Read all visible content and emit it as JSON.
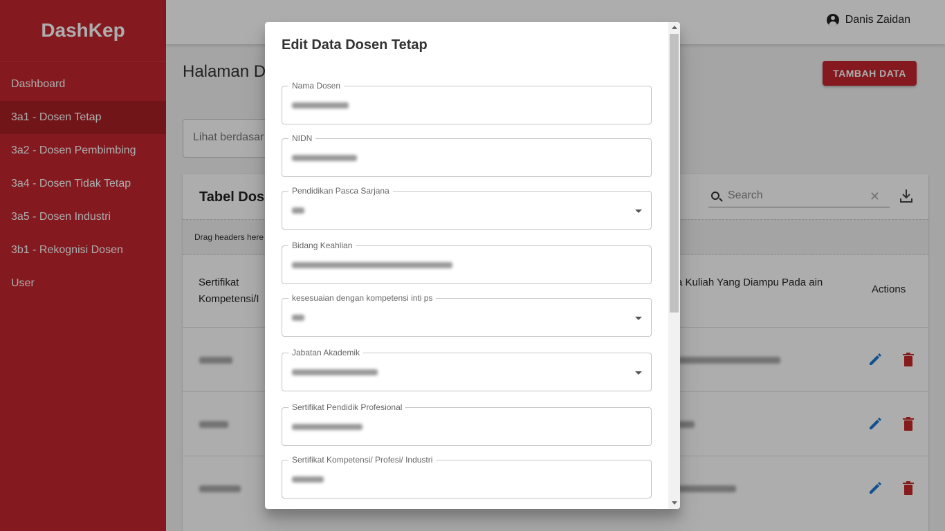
{
  "brand": "DashKep",
  "sidebar": {
    "items": [
      {
        "label": "Dashboard"
      },
      {
        "label": "3a1 - Dosen Tetap"
      },
      {
        "label": "3a2 - Dosen Pembimbing"
      },
      {
        "label": "3a4 - Dosen Tidak Tetap"
      },
      {
        "label": "3a5 - Dosen Industri"
      },
      {
        "label": "3b1 - Rekognisi Dosen"
      },
      {
        "label": "User"
      }
    ],
    "active_index": 1
  },
  "topbar": {
    "user_name": "Danis Zaidan"
  },
  "main": {
    "page_title": "Halaman D",
    "add_button": "TAMBAH DATA",
    "filter_placeholder": "Lihat berdasar",
    "table": {
      "title": "Tabel Dose",
      "search_placeholder": "Search",
      "group_hint": "Drag headers here",
      "col_left": "Sertifikat Kompetensi/I",
      "col_right": "a Kuliah Yang Diampu Pada ain",
      "col_actions": "Actions"
    }
  },
  "modal": {
    "title": "Edit Data Dosen Tetap",
    "fields": [
      {
        "label": "Nama Dosen",
        "type": "text"
      },
      {
        "label": "NIDN",
        "type": "text"
      },
      {
        "label": "Pendidikan Pasca Sarjana",
        "type": "select"
      },
      {
        "label": "Bidang Keahlian",
        "type": "text"
      },
      {
        "label": "kesesuaian dengan kompetensi inti ps",
        "type": "select"
      },
      {
        "label": "Jabatan Akademik",
        "type": "select"
      },
      {
        "label": "Sertifikat Pendidik Profesional",
        "type": "text"
      },
      {
        "label": "Sertifikat Kompetensi/ Profesi/ Industri",
        "type": "text"
      }
    ]
  },
  "colors": {
    "sidebar": "#c3262e",
    "sidebar_active": "#a81f26",
    "primary_button": "#c3262e",
    "edit_icon": "#1976d2",
    "delete_icon": "#c62828"
  },
  "icons": {
    "user": "account-circle-icon",
    "search": "search-icon",
    "clear": "close-icon",
    "download": "download-icon",
    "edit": "pencil-icon",
    "delete": "trash-icon",
    "dropdown": "caret-down-icon"
  }
}
